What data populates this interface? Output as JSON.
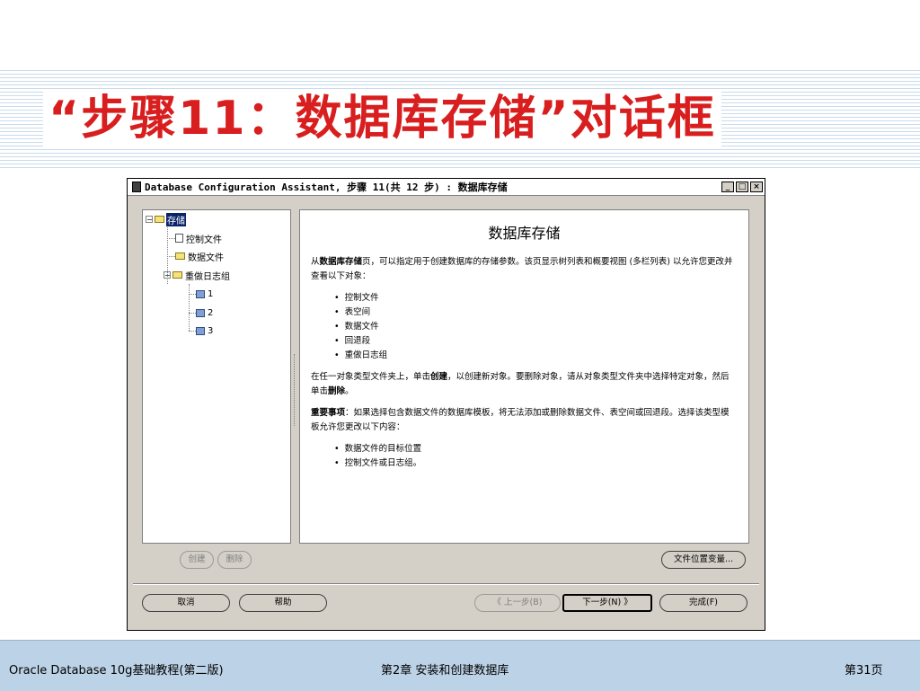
{
  "slide": {
    "title": "“步骤11：数据库存储”对话框"
  },
  "window": {
    "title": "Database Configuration Assistant, 步骤 11(共 12 步) : 数据库存储",
    "buttons": {
      "minimize": "_",
      "maximize": "□",
      "close": "×"
    }
  },
  "tree": {
    "root": "存储",
    "control_file": "控制文件",
    "data_file": "数据文件",
    "redo_group": "重做日志组",
    "redo_items": [
      "1",
      "2",
      "3"
    ]
  },
  "content": {
    "heading": "数据库存储",
    "intro_prefix": "从",
    "intro_bold": "数据库存储",
    "intro_rest": "页，可以指定用于创建数据库的存储参数。该页显示树列表和概要视图 (多栏列表) 以允许您更改并查看以下对象：",
    "objects": [
      "控制文件",
      "表空间",
      "数据文件",
      "回退段",
      "重做日志组"
    ],
    "create_prefix": "在任一对象类型文件夹上，单击",
    "create_bold": "创建",
    "create_mid": "，以创建新对象。要删除对象，请从对象类型文件夹中选择特定对象，然后单击",
    "delete_bold": "删除",
    "create_end": "。",
    "note_bold": "重要事项",
    "note_rest": "：如果选择包含数据文件的数据库模板，将无法添加或删除数据文件、表空间或回退段。选择该类型模板允许您更改以下内容：",
    "changes": [
      "数据文件的目标位置",
      "控制文件或日志组。"
    ]
  },
  "buttons": {
    "create": "创建",
    "delete": "删除",
    "file_location": "文件位置变量...",
    "cancel": "取消",
    "help": "帮助",
    "back": "上一步(B)",
    "next": "下一步(N)",
    "finish": "完成(F)"
  },
  "footer": {
    "left": "Oracle Database 10g基础教程(第二版)",
    "center": "第2章  安装和创建数据库",
    "right": "第31页"
  },
  "colors": {
    "title_red": "#d81e1e",
    "selection": "#0a246a",
    "dialog_gray": "#d4d0c8"
  }
}
